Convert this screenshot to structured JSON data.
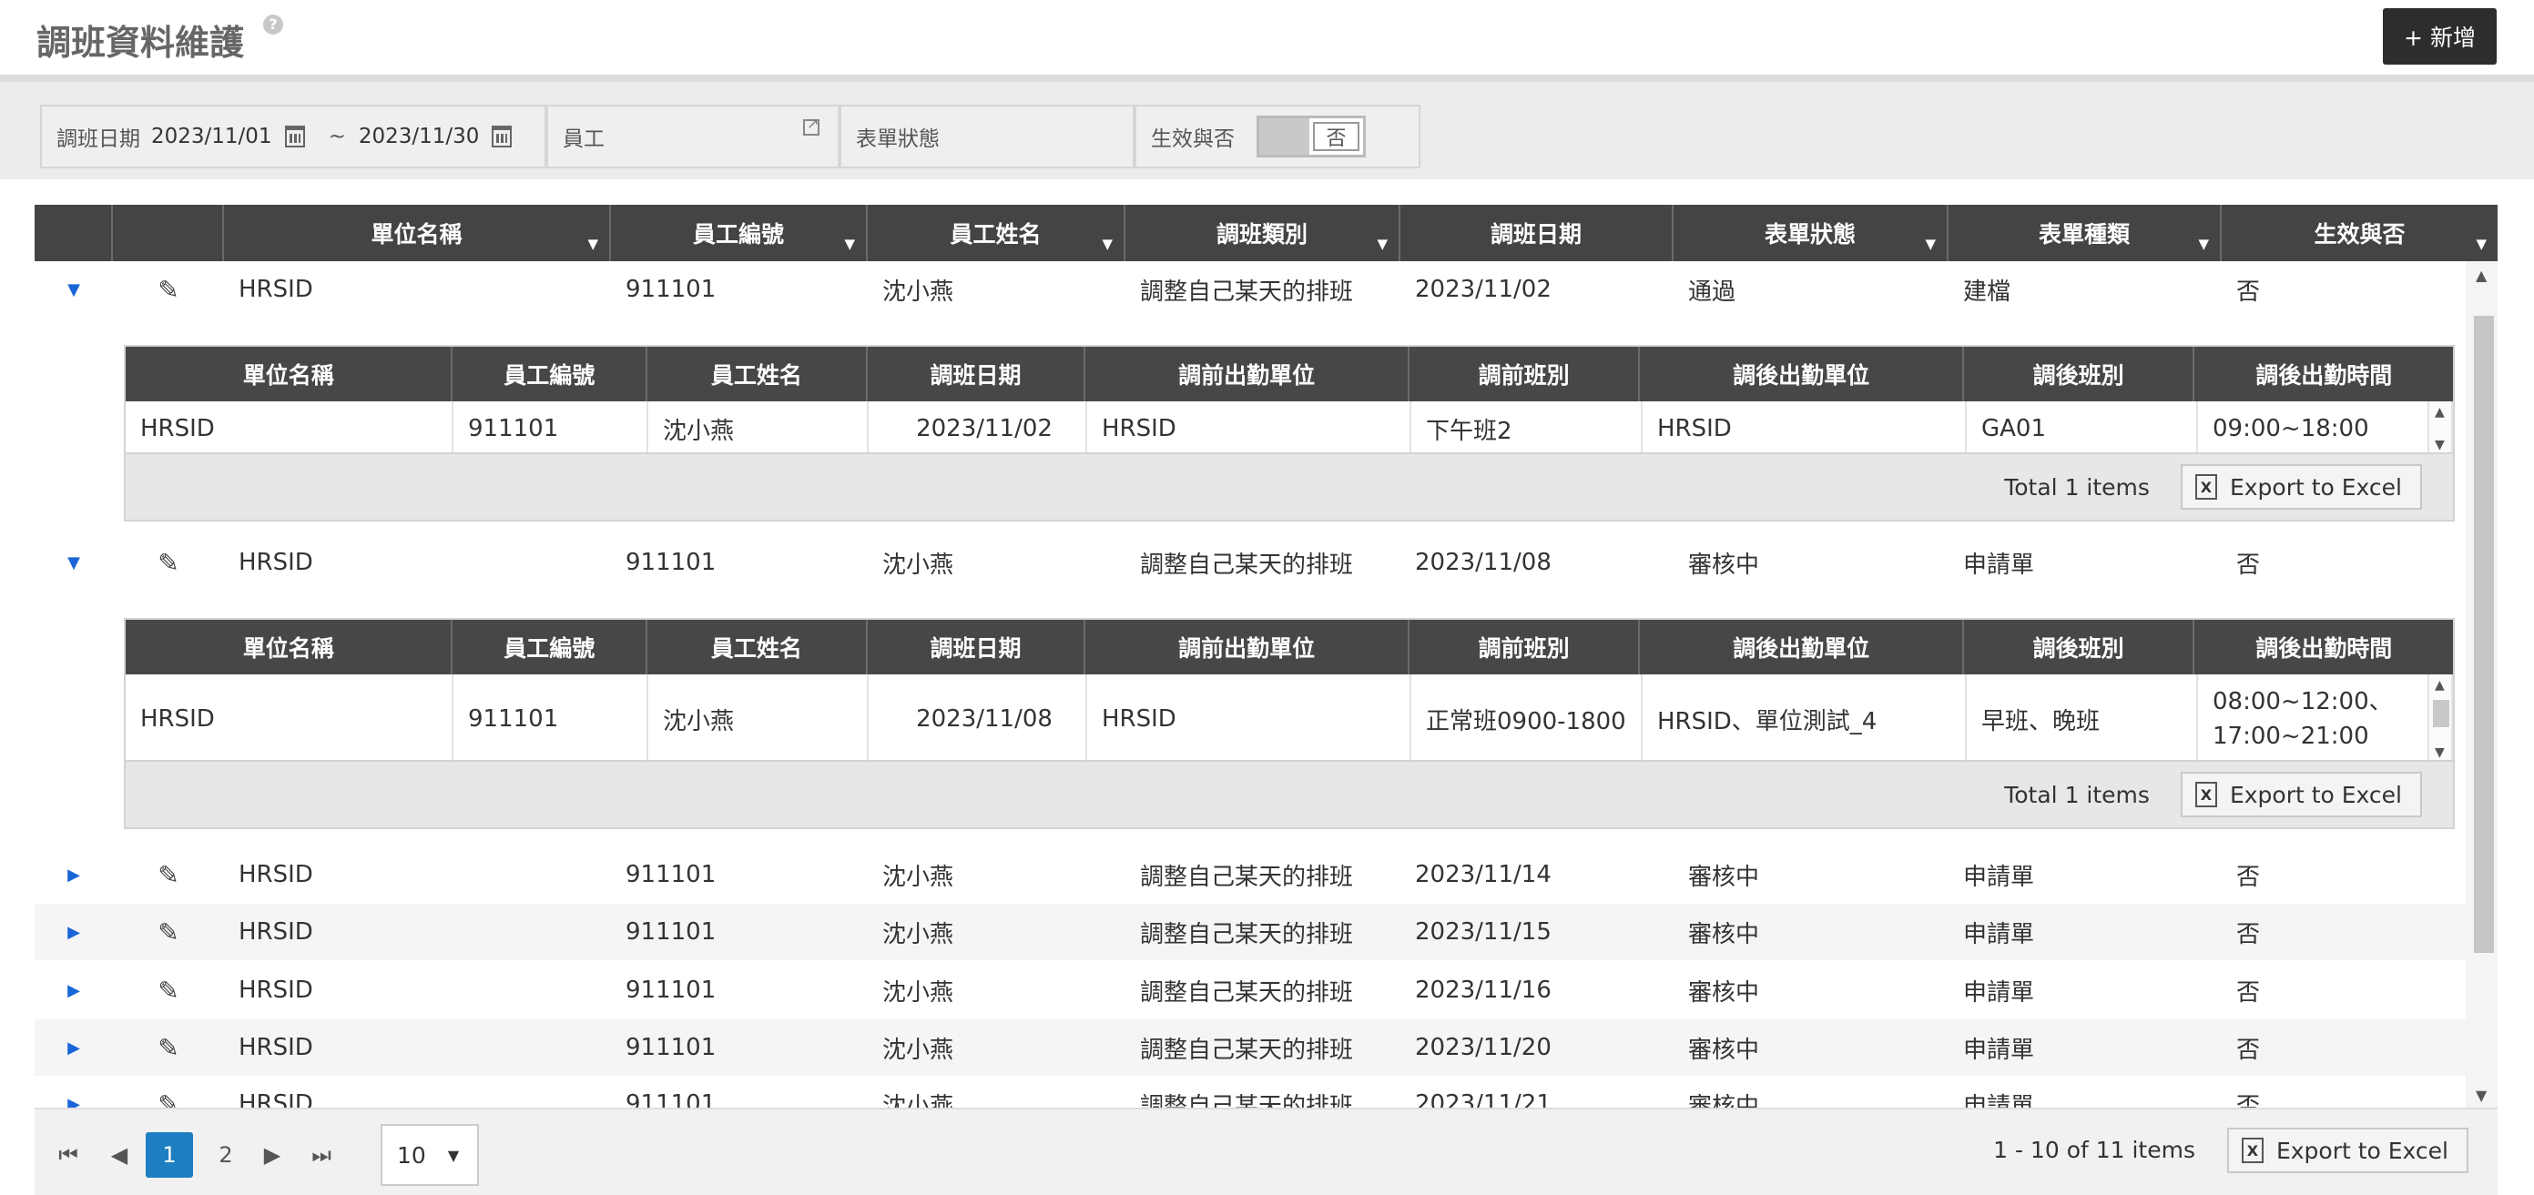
{
  "header": {
    "title": "調班資料維護",
    "help_icon": "question-icon",
    "add_label": "+ 新增"
  },
  "filters": {
    "date_label": "調班日期",
    "date_from": "2023/11/01",
    "date_sep": "~",
    "date_to": "2023/11/30",
    "employee_placeholder": "員工",
    "form_status_placeholder": "表單狀態",
    "effective_label": "生效與否",
    "effective_value": "否"
  },
  "columns": [
    "單位名稱",
    "員工編號",
    "員工姓名",
    "調班類別",
    "調班日期",
    "表單狀態",
    "表單種類",
    "生效與否"
  ],
  "detail_columns": [
    "單位名稱",
    "員工編號",
    "員工姓名",
    "調班日期",
    "調前出勤單位",
    "調前班別",
    "調後出勤單位",
    "調後班別",
    "調後出勤時間"
  ],
  "rows": [
    {
      "unit": "HRSID",
      "emp_no": "911101",
      "emp_name": "沈小燕",
      "type": "調整自己某天的排班",
      "date": "2023/11/02",
      "status": "通過",
      "kind": "建檔",
      "effective": "否"
    },
    {
      "unit": "HRSID",
      "emp_no": "911101",
      "emp_name": "沈小燕",
      "type": "調整自己某天的排班",
      "date": "2023/11/08",
      "status": "審核中",
      "kind": "申請單",
      "effective": "否"
    },
    {
      "unit": "HRSID",
      "emp_no": "911101",
      "emp_name": "沈小燕",
      "type": "調整自己某天的排班",
      "date": "2023/11/14",
      "status": "審核中",
      "kind": "申請單",
      "effective": "否"
    },
    {
      "unit": "HRSID",
      "emp_no": "911101",
      "emp_name": "沈小燕",
      "type": "調整自己某天的排班",
      "date": "2023/11/15",
      "status": "審核中",
      "kind": "申請單",
      "effective": "否"
    },
    {
      "unit": "HRSID",
      "emp_no": "911101",
      "emp_name": "沈小燕",
      "type": "調整自己某天的排班",
      "date": "2023/11/16",
      "status": "審核中",
      "kind": "申請單",
      "effective": "否"
    },
    {
      "unit": "HRSID",
      "emp_no": "911101",
      "emp_name": "沈小燕",
      "type": "調整自己某天的排班",
      "date": "2023/11/20",
      "status": "審核中",
      "kind": "申請單",
      "effective": "否"
    },
    {
      "unit": "HRSID",
      "emp_no": "911101",
      "emp_name": "沈小燕",
      "type": "調整自己某天的排班",
      "date": "2023/11/21",
      "status": "審核中",
      "kind": "申請單",
      "effective": "否"
    }
  ],
  "details": [
    {
      "unit": "HRSID",
      "emp_no": "911101",
      "emp_name": "沈小燕",
      "date": "2023/11/02",
      "pre_unit": "HRSID",
      "pre_shift": "下午班2",
      "post_unit": "HRSID",
      "post_shift": "GA01",
      "post_time_1": "09:00~18:00",
      "post_time_2": "",
      "total": "Total 1 items",
      "export": "Export to Excel"
    },
    {
      "unit": "HRSID",
      "emp_no": "911101",
      "emp_name": "沈小燕",
      "date": "2023/11/08",
      "pre_unit": "HRSID",
      "pre_shift": "正常班0900-1800",
      "post_unit": "HRSID、單位測試_4",
      "post_shift": "早班、晚班",
      "post_time_1": "08:00~12:00、",
      "post_time_2": "17:00~21:00",
      "total": "Total 1 items",
      "export": "Export to Excel"
    }
  ],
  "pager": {
    "first_icon": "first-page-icon",
    "prev_icon": "prev-page-icon",
    "pages": [
      "1",
      "2"
    ],
    "current": "1",
    "next_icon": "next-page-icon",
    "last_icon": "last-page-icon",
    "page_size": "10",
    "info": "1 - 10 of 11 items",
    "export": "Export to Excel"
  }
}
